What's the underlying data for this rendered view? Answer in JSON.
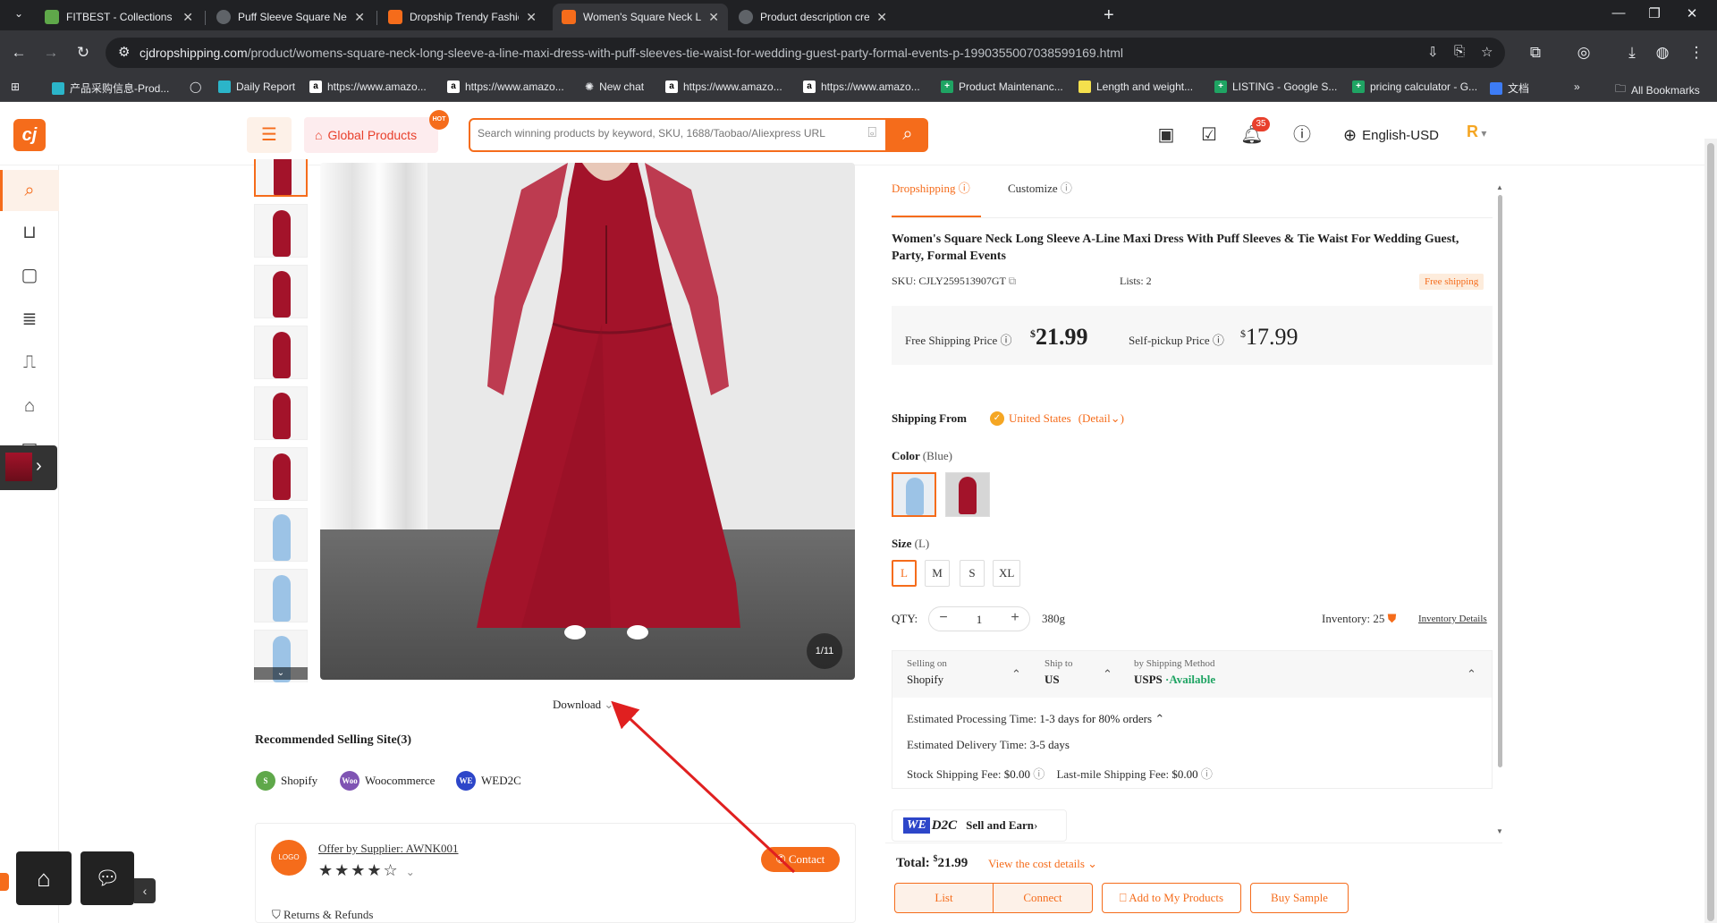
{
  "browser": {
    "tabs": [
      {
        "title": "FITBEST - Collections · Add colle",
        "color": "#5fa84a"
      },
      {
        "title": "Puff Sleeve Square Neck Maxi D",
        "color": "#9aa0a6"
      },
      {
        "title": "Dropship Trendy Fashion Wome",
        "color": "#f56c1b"
      },
      {
        "title": "Women's Square Neck Long Sle",
        "color": "#f56c1b"
      },
      {
        "title": "Product description creation",
        "color": "#9aa0a6"
      }
    ],
    "url_host": "cjdropshipping.com",
    "url_path": "/product/womens-square-neck-long-sleeve-a-line-maxi-dress-with-puff-sleeves-tie-waist-for-wedding-guest-party-formal-events-p-1990355007038599169.html",
    "bookmarks": [
      {
        "label": "产品采购信息-Prod...",
        "color": "#2bb5c9",
        "glyph": ""
      },
      {
        "label": "",
        "color": "#e8eaed",
        "glyph": "◯"
      },
      {
        "label": "Daily Report",
        "color": "#2bb5c9",
        "glyph": ""
      },
      {
        "label": "https://www.amazo...",
        "color": "#ffffff",
        "glyph": "a"
      },
      {
        "label": "https://www.amazo...",
        "color": "#ffffff",
        "glyph": "a"
      },
      {
        "label": "New chat",
        "color": "#e8eaed",
        "glyph": "✺"
      },
      {
        "label": "https://www.amazo...",
        "color": "#ffffff",
        "glyph": "a"
      },
      {
        "label": "https://www.amazo...",
        "color": "#ffffff",
        "glyph": "a"
      },
      {
        "label": "Product Maintenanc...",
        "color": "#1fa463",
        "glyph": "+"
      },
      {
        "label": "Length and weight...",
        "color": "#f4e04d",
        "glyph": ""
      },
      {
        "label": "LISTING - Google S...",
        "color": "#1fa463",
        "glyph": "+"
      },
      {
        "label": "pricing calculator - G...",
        "color": "#1fa463",
        "glyph": "+"
      },
      {
        "label": "文档",
        "color": "#3d7cf5",
        "glyph": ""
      }
    ],
    "all_bookmarks": "All Bookmarks"
  },
  "header": {
    "global_products": "Global Products",
    "hot": "HOT",
    "search_placeholder": "Search winning products by keyword, SKU, 1688/Taobao/Aliexpress URL",
    "notification_count": "35",
    "language": "English-USD",
    "avatar_letter": "R"
  },
  "gallery": {
    "counter": "1/11",
    "download": "Download",
    "thumb_colors": [
      "#a3132a",
      "#a3132a",
      "#a3132a",
      "#a3132a",
      "#a3132a",
      "#a3132a",
      "#9cc3e6",
      "#9cc3e6",
      "#9cc3e6"
    ]
  },
  "recommended": {
    "title": "Recommended Selling Site(3)",
    "sites": [
      {
        "name": "Shopify",
        "color": "#5fa84a",
        "glyph": "S"
      },
      {
        "name": "Woocommerce",
        "color": "#7f54b3",
        "glyph": "Woo"
      },
      {
        "name": "WED2C",
        "color": "#2d46c9",
        "glyph": "WE"
      }
    ]
  },
  "supplier": {
    "logo": "LOGO",
    "name": "Offer by Supplier: AWNK001",
    "rating": 4,
    "stars": "★★★★☆",
    "contact": "Contact",
    "returns": "Returns & Refunds"
  },
  "product": {
    "tab_dropshipping": "Dropshipping",
    "tab_customize": "Customize",
    "title": "Women's Square Neck Long Sleeve A-Line Maxi Dress With Puff Sleeves & Tie Waist For Wedding Guest, Party, Formal Events",
    "sku_label": "SKU:",
    "sku": "CJLY259513907GT",
    "lists": "Lists: 2",
    "free_shipping": "Free shipping",
    "free_shipping_price_label": "Free Shipping Price",
    "free_shipping_price": "21.99",
    "self_pickup_label": "Self-pickup Price",
    "self_pickup_price": "17.99",
    "currency": "$",
    "shipping_from_label": "Shipping From",
    "shipping_from": "United States",
    "detail": "(Detail",
    "color_label": "Color",
    "color_value": "(Blue)",
    "size_label": "Size",
    "size_value": "(L)",
    "sizes": [
      "L",
      "M",
      "S",
      "XL"
    ],
    "qty_label": "QTY:",
    "qty": "1",
    "weight": "380g",
    "inventory": "Inventory: 25",
    "inventory_details": "Inventory Details"
  },
  "shipping": {
    "selling_on_label": "Selling on",
    "selling_on": "Shopify",
    "ship_to_label": "Ship to",
    "ship_to": "US",
    "method_label": "by Shipping Method",
    "method": "USPS",
    "available": "·Available",
    "processing_label": "Estimated Processing Time:",
    "processing": "1-3 days for 80% orders",
    "delivery_label": "Estimated Delivery Time:",
    "delivery": "3-5 days",
    "stock_fee_label": "Stock Shipping Fee:",
    "stock_fee": "$0.00",
    "lastmile_label": "Last-mile Shipping Fee:",
    "lastmile_fee": "$0.00"
  },
  "wed2c": {
    "logo_a": "WE",
    "logo_b": "D2C",
    "text": "Sell and Earn"
  },
  "footer": {
    "total_label": "Total:",
    "total_currency": "$",
    "total": "21.99",
    "cost_details": "View the cost details",
    "list": "List",
    "connect": "Connect",
    "add_to_products": "Add to My Products",
    "buy_sample": "Buy Sample"
  },
  "colors": {
    "accent": "#f56c1b",
    "dress_red": "#a3132a",
    "dress_blue": "#9cc3e6",
    "available_green": "#1fa463",
    "annotation_red": "#e02020"
  }
}
